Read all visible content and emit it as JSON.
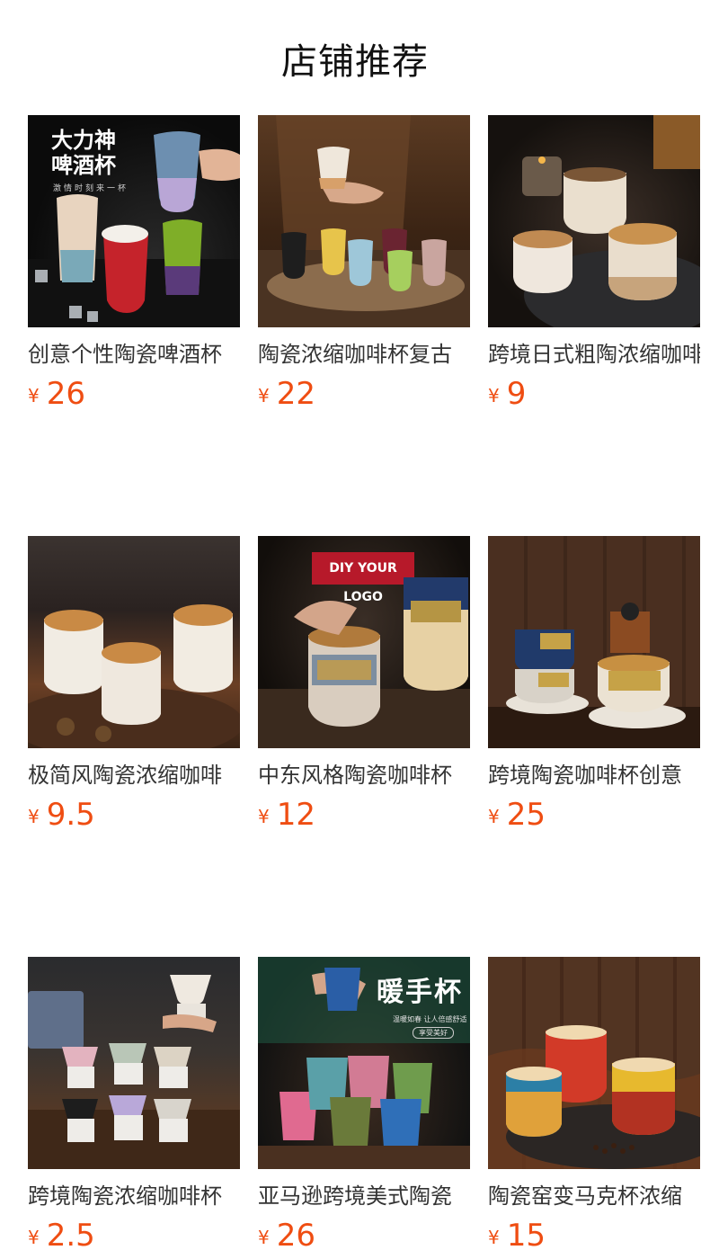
{
  "header": {
    "title": "店铺推荐"
  },
  "products": [
    {
      "name": "创意个性陶瓷啤酒杯",
      "currency": "¥",
      "price": "26",
      "overlay": [
        "大力神",
        "啤酒杯",
        "激情时刻来一杯"
      ]
    },
    {
      "name": "陶瓷浓缩咖啡杯复古",
      "currency": "¥",
      "price": "22"
    },
    {
      "name": "跨境日式粗陶浓缩咖啡",
      "currency": "¥",
      "price": "9"
    },
    {
      "name": "极简风陶瓷浓缩咖啡",
      "currency": "¥",
      "price": "9.5"
    },
    {
      "name": "中东风格陶瓷咖啡杯",
      "currency": "¥",
      "price": "12",
      "overlay": [
        "DIY YOUR LOGO"
      ]
    },
    {
      "name": "跨境陶瓷咖啡杯创意",
      "currency": "¥",
      "price": "25"
    },
    {
      "name": "跨境陶瓷浓缩咖啡杯",
      "currency": "¥",
      "price": "2.5"
    },
    {
      "name": "亚马逊跨境美式陶瓷",
      "currency": "¥",
      "price": "26",
      "overlay": [
        "暖手杯",
        "温暖如春 让人倍感舒适",
        "享受美好"
      ]
    },
    {
      "name": "陶瓷窑变马克杯浓缩",
      "currency": "¥",
      "price": "15"
    }
  ]
}
